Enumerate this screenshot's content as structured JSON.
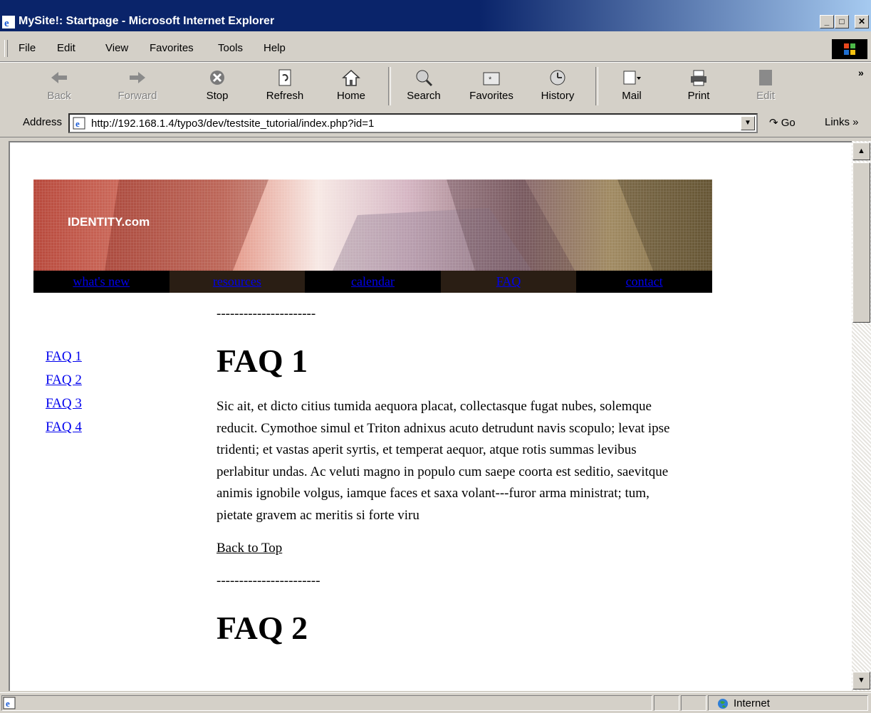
{
  "window": {
    "title": "MySite!: Startpage - Microsoft Internet Explorer",
    "min_glyph": "_",
    "max_glyph": "□",
    "close_glyph": "✕"
  },
  "menubar": {
    "items": [
      {
        "label": "File"
      },
      {
        "label": "Edit"
      },
      {
        "label": "View"
      },
      {
        "label": "Favorites"
      },
      {
        "label": "Tools"
      },
      {
        "label": "Help"
      }
    ]
  },
  "toolbar": {
    "back": "Back",
    "forward": "Forward",
    "stop": "Stop",
    "refresh": "Refresh",
    "home": "Home",
    "search": "Search",
    "favorites": "Favorites",
    "history": "History",
    "mail": "Mail",
    "print": "Print",
    "edit": "Edit",
    "more": "»"
  },
  "addressbar": {
    "label": "Address",
    "url": "http://192.168.1.4/typo3/dev/testsite_tutorial/index.php?id=1",
    "go": "Go",
    "links": "Links »"
  },
  "page": {
    "banner_text": "IDENTITY.com",
    "nav": [
      {
        "label": "what's new"
      },
      {
        "label": "resources"
      },
      {
        "label": "calendar"
      },
      {
        "label": "FAQ"
      },
      {
        "label": "contact"
      }
    ],
    "sidebar": [
      {
        "label": "FAQ 1"
      },
      {
        "label": "FAQ 2"
      },
      {
        "label": "FAQ 3"
      },
      {
        "label": "FAQ 4"
      }
    ],
    "divider_1": "----------------------",
    "faq1_heading": "FAQ 1",
    "faq1_body": "Sic ait, et dicto citius tumida aequora placat, collectasque fugat nubes, solemque reducit. Cymothoe simul et Triton adnixus acuto detrudunt navis scopulo; levat ipse tridenti; et vastas aperit syrtis, et temperat aequor, atque rotis summas levibus perlabitur undas. Ac veluti magno in populo cum saepe coorta est seditio, saevitque animis ignobile volgus, iamque faces et saxa volant---furor arma ministrat; tum, pietate gravem ac meritis si forte viru",
    "back_to_top": "Back to Top",
    "divider_2": "-----------------------",
    "faq2_heading": "FAQ 2"
  },
  "statusbar": {
    "zone": "Internet"
  },
  "colors": {
    "titlebar": "#0a246a",
    "link": "#0000ee",
    "nav_dark": "#000000",
    "nav_brown": "#2a1e14"
  }
}
